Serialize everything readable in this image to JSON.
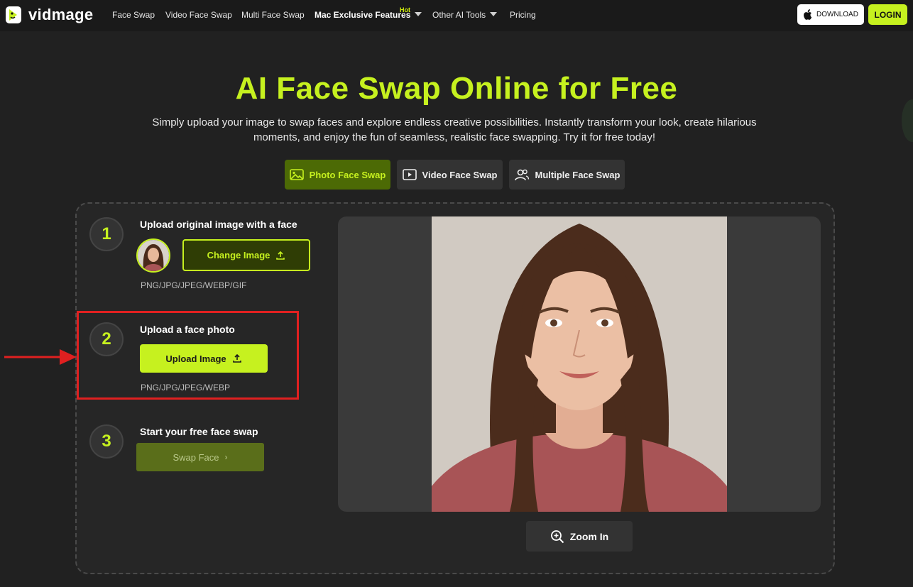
{
  "nav": {
    "logo_text": "vidmage",
    "items": [
      "Face Swap",
      "Video Face Swap",
      "Multi Face Swap"
    ],
    "mac_label": "Mac Exclusive Features",
    "hot_badge": "Hot",
    "other_tools_label": "Other AI Tools",
    "pricing_label": "Pricing",
    "download_label": "DOWNLOAD",
    "login_label": "LOGIN"
  },
  "hero": {
    "title": "AI Face Swap Online for Free",
    "subtitle": "Simply upload your image to swap faces and explore endless creative possibilities. Instantly transform your look, create hilarious moments, and enjoy the fun of seamless, realistic face swapping. Try it for free today!"
  },
  "tabs": [
    {
      "label": "Photo Face Swap",
      "icon": "image-icon",
      "active": true
    },
    {
      "label": "Video Face Swap",
      "icon": "play-icon",
      "active": false
    },
    {
      "label": "Multiple Face Swap",
      "icon": "users-icon",
      "active": false
    }
  ],
  "steps": [
    {
      "number": "1",
      "title": "Upload original image with a face",
      "button": "Change Image",
      "formats": "PNG/JPG/JPEG/WEBP/GIF"
    },
    {
      "number": "2",
      "title": "Upload a face photo",
      "button": "Upload Image",
      "formats": "PNG/JPG/JPEG/WEBP"
    },
    {
      "number": "3",
      "title": "Start your free face swap",
      "button": "Swap Face"
    }
  ],
  "preview": {
    "zoom_label": "Zoom In"
  },
  "colors": {
    "accent": "#c6f11f",
    "background": "#212121",
    "highlight": "#e02020"
  }
}
